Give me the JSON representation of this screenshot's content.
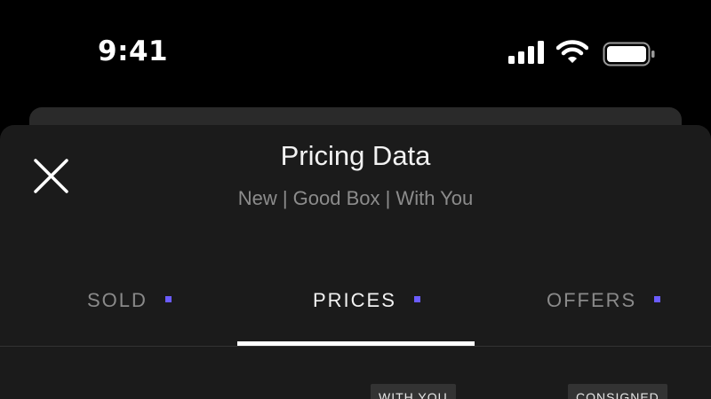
{
  "status_bar": {
    "time": "9:41",
    "icons": [
      "cellular-signal-icon",
      "wifi-icon",
      "battery-icon"
    ]
  },
  "sheet": {
    "title": "Pricing Data",
    "subtitle": "New | Good Box | With You",
    "close_icon": "close-icon"
  },
  "tabs": [
    {
      "label": "SOLD",
      "active": false
    },
    {
      "label": "PRICES",
      "active": true
    },
    {
      "label": "OFFERS",
      "active": false
    }
  ],
  "badges": {
    "with_you": "WITH YOU",
    "consigned": "CONSIGNED"
  },
  "colors": {
    "background": "#000000",
    "sheet": "#1b1b1b",
    "accent": "#6b5cff",
    "active_text": "#f2f2f2",
    "inactive_text": "#8a8a8a"
  }
}
